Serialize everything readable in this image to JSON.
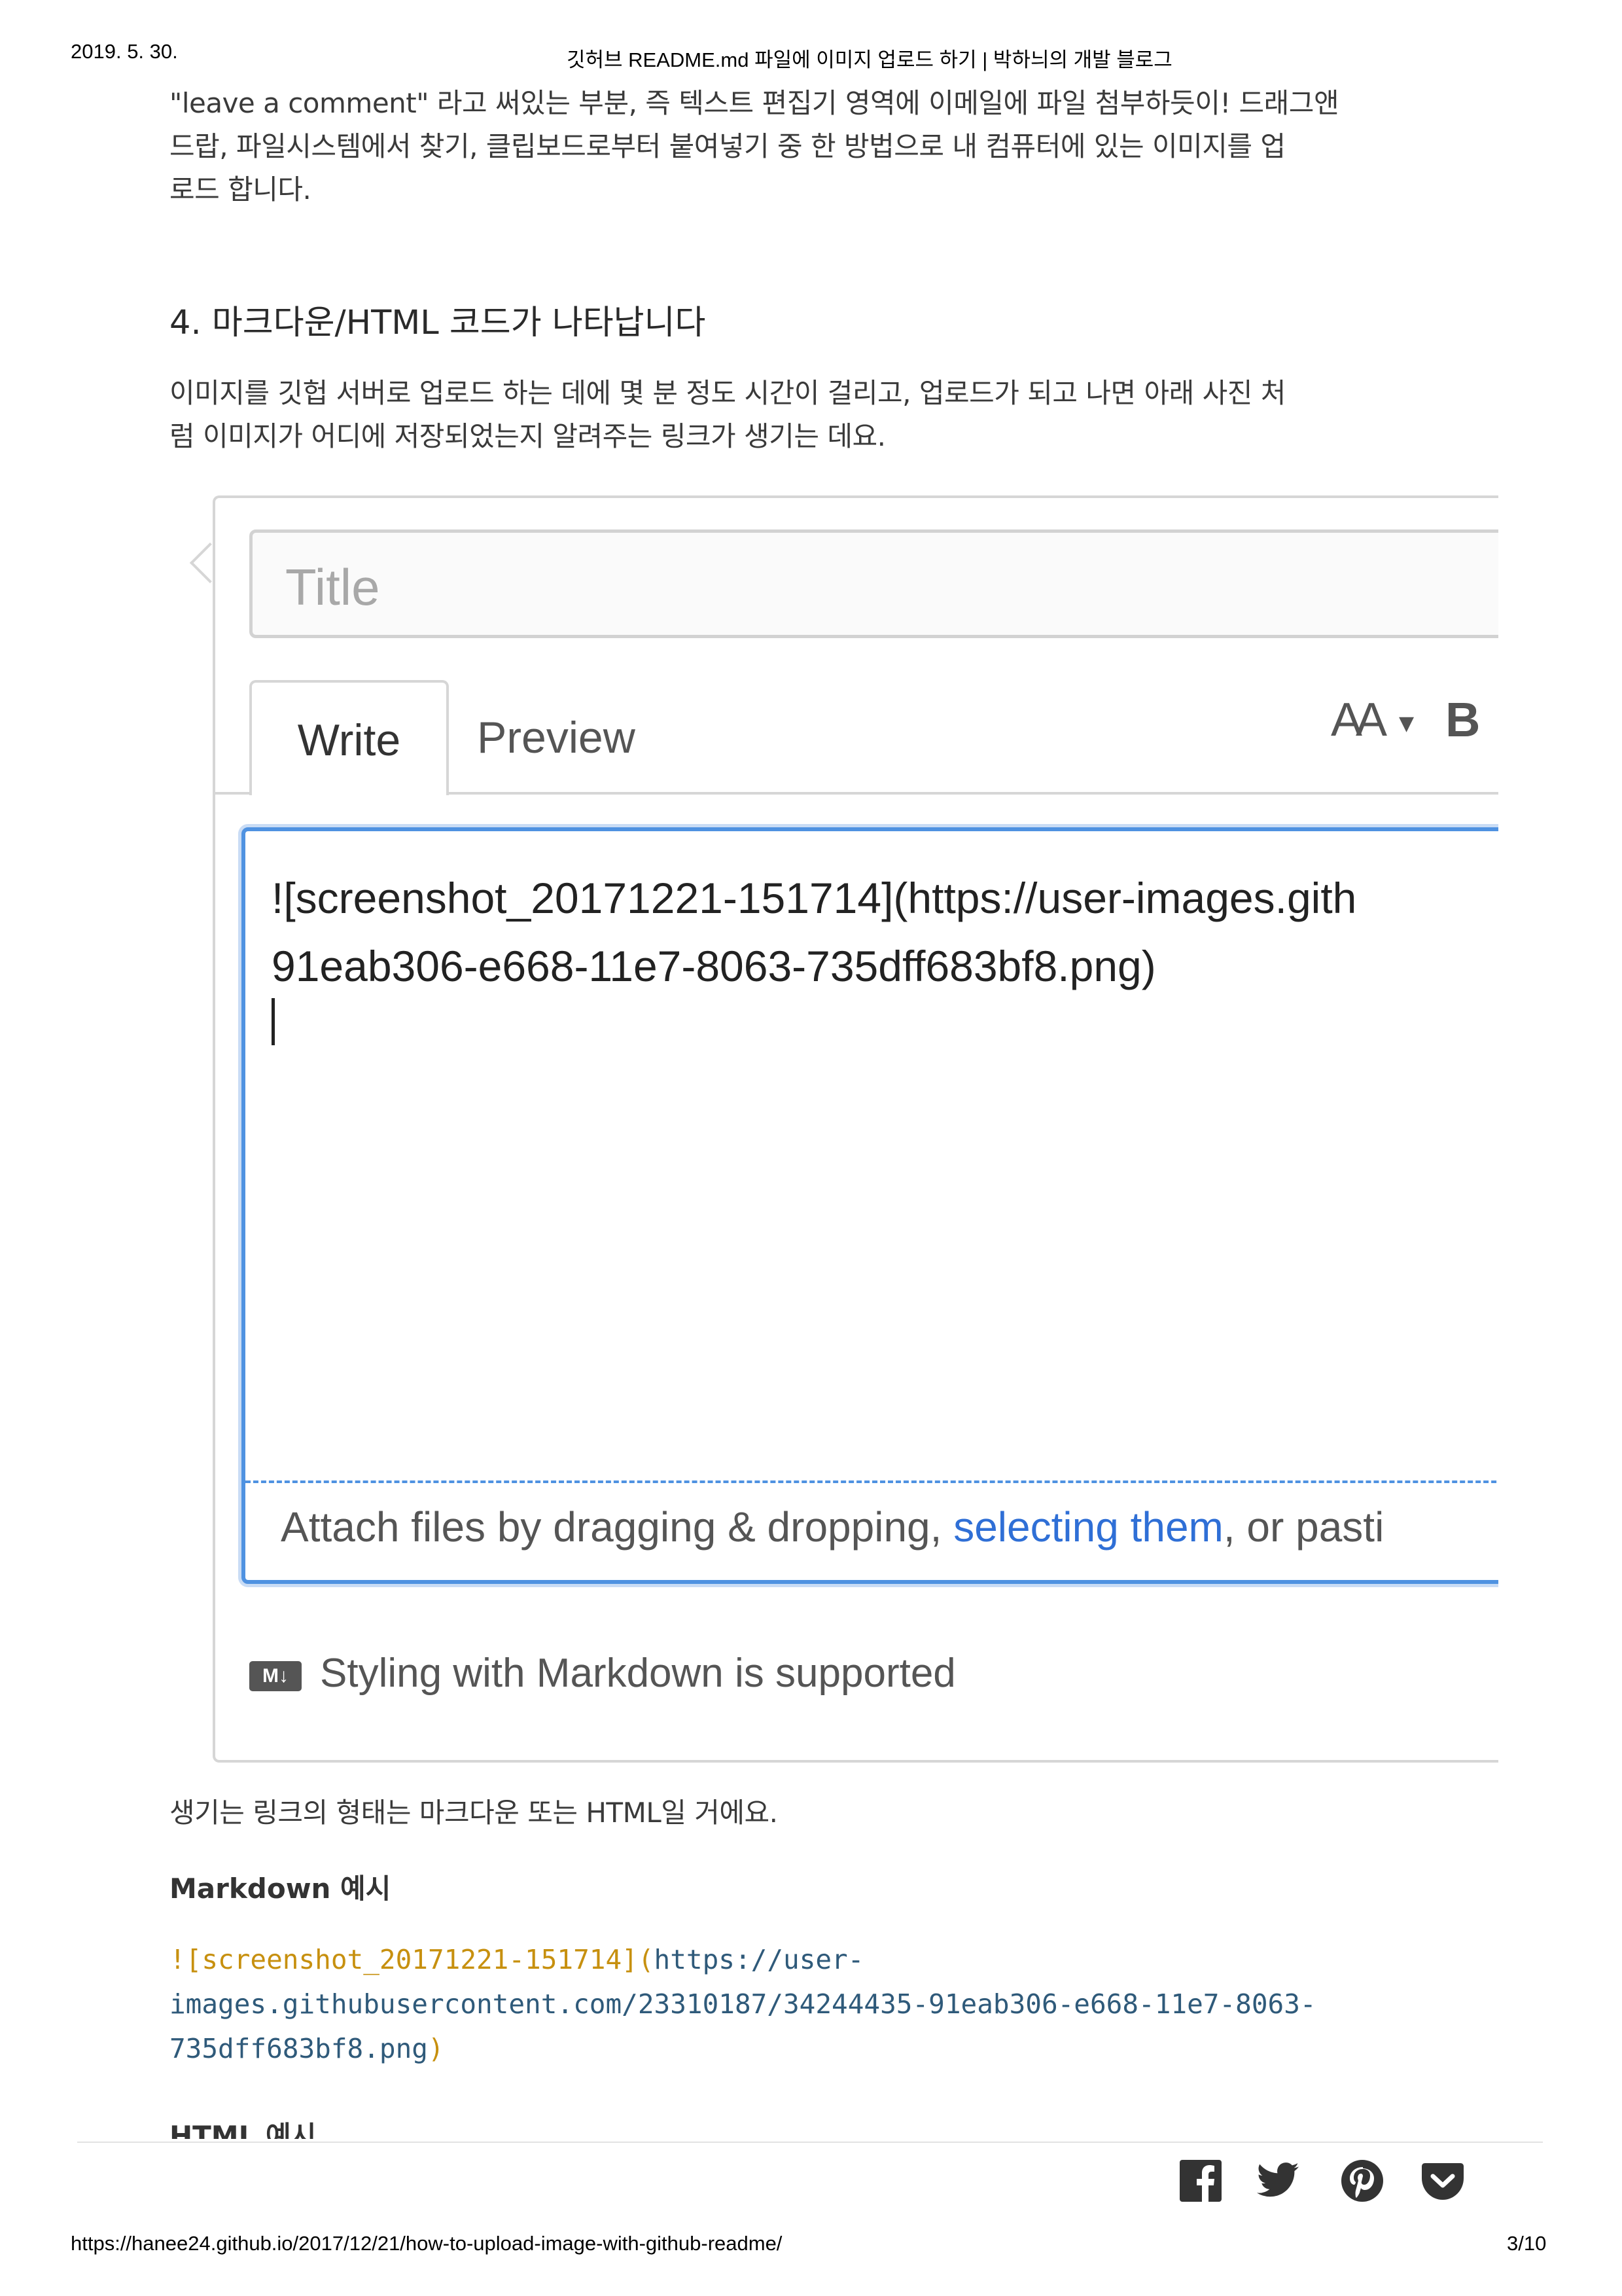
{
  "print_header": {
    "date": "2019. 5. 30.",
    "title": "깃허브 README.md 파일에 이미지 업로드 하기 | 박하늬의 개발 블로그"
  },
  "paragraph1": [
    "\"leave a comment\" 라고 써있는 부분, 즉 텍스트 편집기 영역에 이메일에 파일 첨부하듯이! 드래그앤",
    "드랍, 파일시스템에서 찾기, 클립보드로부터 붙여넣기 중 한 방법으로 내 컴퓨터에 있는 이미지를 업",
    "로드 합니다."
  ],
  "heading4": "4. 마크다운/HTML 코드가 나타납니다",
  "paragraph2": [
    "이미지를 깃헙 서버로 업로드 하는 데에 몇 분 정도 시간이 걸리고, 업로드가 되고 나면 아래 사진 처",
    "럼 이미지가 어디에 저장되었는지 알려주는 링크가 생기는 데요."
  ],
  "screenshot": {
    "title_placeholder": "Title",
    "tabs": [
      "Write",
      "Preview"
    ],
    "toolbar_text_size": "AA",
    "toolbar_bold": "B",
    "editor_line1": "![screenshot_20171221-151714](https://user-images.gith",
    "editor_line2": "91eab306-e668-11e7-8063-735dff683bf8.png)",
    "attach_prefix": "Attach files by dragging & dropping, ",
    "attach_link": "selecting them",
    "attach_suffix": ", or pasti",
    "md_badge": "M↓",
    "md_note": "Styling with Markdown is supported"
  },
  "paragraph3": "생기는 링크의 형태는 마크다운 또는 HTML일 거에요.",
  "markdown_example": {
    "label": "Markdown 예시",
    "code_alt": "![screenshot_20171221-151714](",
    "code_url_line1": "https://user-",
    "code_url_line2": "images.githubusercontent.com/23310187/34244435-91eab306-e668-11e7-8063-",
    "code_url_line3": "735dff683bf8.png",
    "code_close": ")"
  },
  "html_example_label": "HTML 예시",
  "share_icons": [
    "facebook-icon",
    "twitter-icon",
    "pinterest-icon",
    "pocket-icon"
  ],
  "print_footer": {
    "url": "https://hanee24.github.io/2017/12/21/how-to-upload-image-with-github-readme/",
    "page": "3/10"
  }
}
